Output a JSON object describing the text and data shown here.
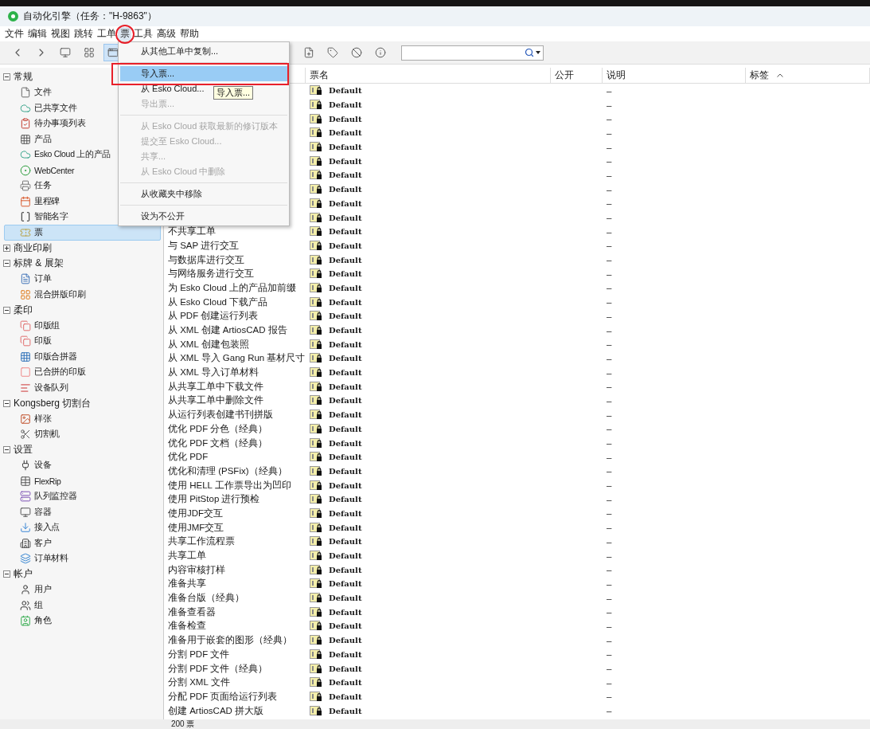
{
  "window": {
    "title": "自动化引擎（任务：\"H-9863\"）"
  },
  "menu_bar": [
    {
      "label": "文件",
      "selected": false
    },
    {
      "label": "编辑",
      "selected": false
    },
    {
      "label": "视图",
      "selected": false
    },
    {
      "label": "跳转",
      "selected": false
    },
    {
      "label": "工单",
      "selected": false
    },
    {
      "label": "票",
      "selected": true
    },
    {
      "label": "工具",
      "selected": false
    },
    {
      "label": "高级",
      "selected": false
    },
    {
      "label": "帮助",
      "selected": false
    }
  ],
  "sidebar": {
    "groups": [
      {
        "label": "常规",
        "expanded": true,
        "children": [
          {
            "label": "文件",
            "selected": false
          },
          {
            "label": "已共享文件",
            "selected": false
          },
          {
            "label": "待办事项列表",
            "selected": false
          },
          {
            "label": "产品",
            "selected": false
          },
          {
            "label": "Esko Cloud 上的产品",
            "selected": false
          },
          {
            "label": "WebCenter",
            "selected": false
          },
          {
            "label": "任务",
            "selected": false
          },
          {
            "label": "里程碑",
            "selected": false
          },
          {
            "label": "智能名字",
            "selected": false
          },
          {
            "label": "票",
            "selected": true
          }
        ]
      },
      {
        "label": "商业印刷",
        "expanded": false
      },
      {
        "label": "标牌 & 展架",
        "expanded": true,
        "children": [
          {
            "label": "订单",
            "selected": false
          },
          {
            "label": "混合拼版印刷",
            "selected": false
          }
        ]
      },
      {
        "label": "柔印",
        "expanded": true,
        "children": [
          {
            "label": "印版组",
            "selected": false
          },
          {
            "label": "印版",
            "selected": false
          },
          {
            "label": "印版合拼器",
            "selected": false
          },
          {
            "label": "已合拼的印版",
            "selected": false
          },
          {
            "label": "设备队列",
            "selected": false
          }
        ]
      },
      {
        "label": "Kongsberg 切割台",
        "expanded": true,
        "children": [
          {
            "label": "样张",
            "selected": false
          },
          {
            "label": "切割机",
            "selected": false
          }
        ]
      },
      {
        "label": "设置",
        "expanded": true,
        "children": [
          {
            "label": "设备",
            "selected": false
          },
          {
            "label": "FlexRip",
            "selected": false
          },
          {
            "label": "队列监控器",
            "selected": false
          },
          {
            "label": "容器",
            "selected": false
          },
          {
            "label": "接入点",
            "selected": false
          },
          {
            "label": "客户",
            "selected": false
          },
          {
            "label": "订单材料",
            "selected": false
          }
        ]
      },
      {
        "label": "帐户",
        "expanded": true,
        "children": [
          {
            "label": "用户",
            "selected": false
          },
          {
            "label": "组",
            "selected": false
          },
          {
            "label": "角色",
            "selected": false
          }
        ]
      }
    ]
  },
  "table": {
    "columns": [
      {
        "label": "票名"
      },
      {
        "label": "公开"
      },
      {
        "label": "说明"
      },
      {
        "label": "标签",
        "sorted": true
      }
    ],
    "rows": [
      {
        "ticket": "Default",
        "description": "–"
      },
      {
        "ticket": "Default",
        "description": "–"
      },
      {
        "ticket": "Default",
        "description": "–"
      },
      {
        "ticket": "Default",
        "description": "–"
      },
      {
        "ticket": "Default",
        "description": "–"
      },
      {
        "ticket": "Default",
        "description": "–"
      },
      {
        "ticket": "Default",
        "description": "–"
      },
      {
        "ticket": "Default",
        "description": "–"
      },
      {
        "ticket": "Default",
        "description": "–"
      },
      {
        "ticket": "Default",
        "description": "–"
      },
      {
        "name": "不共享工单",
        "ticket": "Default",
        "description": "–"
      },
      {
        "name": "与 SAP 进行交互",
        "ticket": "Default",
        "description": "–"
      },
      {
        "name": "与数据库进行交互",
        "ticket": "Default",
        "description": "–"
      },
      {
        "name": "与网络服务进行交互",
        "ticket": "Default",
        "description": "–"
      },
      {
        "name": "为 Esko Cloud 上的产品加前缀",
        "ticket": "Default",
        "description": "–"
      },
      {
        "name": "从 Esko Cloud 下载产品",
        "ticket": "Default",
        "description": "–"
      },
      {
        "name": "从 PDF 创建运行列表",
        "ticket": "Default",
        "description": "–"
      },
      {
        "name": "从 XML 创建 ArtiosCAD 报告",
        "ticket": "Default",
        "description": "–"
      },
      {
        "name": "从 XML 创建包装照",
        "ticket": "Default",
        "description": "–"
      },
      {
        "name": "从 XML 导入 Gang Run 基材尺寸",
        "ticket": "Default",
        "description": "–"
      },
      {
        "name": "从 XML 导入订单材料",
        "ticket": "Default",
        "description": "–"
      },
      {
        "name": "从共享工单中下载文件",
        "ticket": "Default",
        "description": "–"
      },
      {
        "name": "从共享工单中删除文件",
        "ticket": "Default",
        "description": "–"
      },
      {
        "name": "从运行列表创建书刊拼版",
        "ticket": "Default",
        "description": "–"
      },
      {
        "name": "优化 PDF 分色（经典）",
        "ticket": "Default",
        "description": "–"
      },
      {
        "name": "优化 PDF 文档（经典）",
        "ticket": "Default",
        "description": "–"
      },
      {
        "name": "优化 PDF",
        "ticket": "Default",
        "description": "–"
      },
      {
        "name": "优化和清理 (PSFix)（经典）",
        "ticket": "Default",
        "description": "–"
      },
      {
        "name": "使用 HELL 工作票导出为凹印",
        "ticket": "Default",
        "description": "–"
      },
      {
        "name": "使用 PitStop 进行预检",
        "ticket": "Default",
        "description": "–"
      },
      {
        "name": "使用JDF交互",
        "ticket": "Default",
        "description": "–"
      },
      {
        "name": "使用JMF交互",
        "ticket": "Default",
        "description": "–"
      },
      {
        "name": "共享工作流程票",
        "ticket": "Default",
        "description": "–"
      },
      {
        "name": "共享工单",
        "ticket": "Default",
        "description": "–"
      },
      {
        "name": "内容审核打样",
        "ticket": "Default",
        "description": "–"
      },
      {
        "name": "准备共享",
        "ticket": "Default",
        "description": "–"
      },
      {
        "name": "准备台版（经典）",
        "ticket": "Default",
        "description": "–"
      },
      {
        "name": "准备查看器",
        "ticket": "Default",
        "description": "–"
      },
      {
        "name": "准备检查",
        "ticket": "Default",
        "description": "–"
      },
      {
        "name": "准备用于嵌套的图形（经典）",
        "ticket": "Default",
        "description": "–"
      },
      {
        "name": "分割 PDF 文件",
        "ticket": "Default",
        "description": "–"
      },
      {
        "name": "分割 PDF 文件（经典）",
        "ticket": "Default",
        "description": "–"
      },
      {
        "name": "分割 XML 文件",
        "ticket": "Default",
        "description": "–"
      },
      {
        "name": "分配 PDF 页面给运行列表",
        "ticket": "Default",
        "description": "–"
      },
      {
        "name": "创建 ArtiosCAD 拼大版",
        "ticket": "Default",
        "description": "–"
      }
    ]
  },
  "dropdown_menu": {
    "items": [
      {
        "kind": "item",
        "label": "从其他工单中复制...",
        "disabled": false,
        "selected": false
      },
      {
        "kind": "separator"
      },
      {
        "kind": "item",
        "label": "导入票...",
        "disabled": false,
        "selected": true
      },
      {
        "kind": "item",
        "label": "从 Esko Cloud...",
        "disabled": false,
        "selected": false
      },
      {
        "kind": "item",
        "label": "导出票...",
        "disabled": true,
        "selected": false
      },
      {
        "kind": "separator"
      },
      {
        "kind": "item",
        "label": "从 Esko Cloud 获取最新的修订版本",
        "disabled": true,
        "selected": false
      },
      {
        "kind": "item",
        "label": "提交至 Esko Cloud...",
        "disabled": true,
        "selected": false
      },
      {
        "kind": "item",
        "label": "共享...",
        "disabled": true,
        "selected": false
      },
      {
        "kind": "item",
        "label": "从 Esko Cloud 中删除",
        "disabled": true,
        "selected": false
      },
      {
        "kind": "separator"
      },
      {
        "kind": "item",
        "label": "从收藏夹中移除",
        "disabled": false,
        "selected": false
      },
      {
        "kind": "separator"
      },
      {
        "kind": "item",
        "label": "设为不公开",
        "disabled": false,
        "selected": false
      }
    ]
  },
  "tooltip": {
    "text": "导入票..."
  },
  "status_bar": {
    "text": "200 票"
  }
}
